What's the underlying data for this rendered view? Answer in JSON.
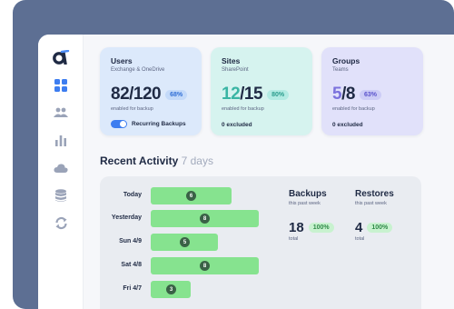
{
  "colors": {
    "users_card": "#dce9fb",
    "sites_card": "#d6f3ef",
    "groups_card": "#e1e1fa",
    "bar_green": "#86e38f",
    "brand": "#1f2a44"
  },
  "sidebar": {
    "logo": "brand-logo-icon",
    "items": [
      {
        "icon": "dashboard-icon",
        "active": true
      },
      {
        "icon": "users-icon"
      },
      {
        "icon": "bar-chart-icon"
      },
      {
        "icon": "cloud-icon"
      },
      {
        "icon": "database-icon"
      },
      {
        "icon": "sync-icon"
      }
    ]
  },
  "cards": [
    {
      "title": "Users",
      "subtitle": "Exchange & OneDrive",
      "count": "82/120",
      "percent": "68%",
      "caption": "enabled for backup",
      "footer": "Recurring Backups",
      "toggle_on": true
    },
    {
      "title": "Sites",
      "subtitle": "SharePoint",
      "count_num": "12",
      "count_den": "/15",
      "percent": "80%",
      "caption": "enabled for backup",
      "footer": "0 excluded"
    },
    {
      "title": "Groups",
      "subtitle": "Teams",
      "count_num": "5",
      "count_den": "/8",
      "percent": "63%",
      "caption": "enabled for backup",
      "footer": "0 excluded"
    }
  ],
  "activity": {
    "title": "Recent Activity",
    "range": "7 days",
    "rows": [
      {
        "label": "Today",
        "value": "6",
        "fill": 0.75
      },
      {
        "label": "Yesterday",
        "value": "8",
        "fill": 1.0
      },
      {
        "label": "Sun 4/9",
        "value": "5",
        "fill": 0.62
      },
      {
        "label": "Sat 4/8",
        "value": "8",
        "fill": 1.0
      },
      {
        "label": "Fri 4/7",
        "value": "3",
        "fill": 0.37
      }
    ],
    "stats": [
      {
        "heading": "Backups",
        "period": "this past week",
        "value": "18",
        "percent": "100%",
        "unit": "total"
      },
      {
        "heading": "Restores",
        "period": "this past week",
        "value": "4",
        "percent": "100%",
        "unit": "total"
      }
    ]
  }
}
